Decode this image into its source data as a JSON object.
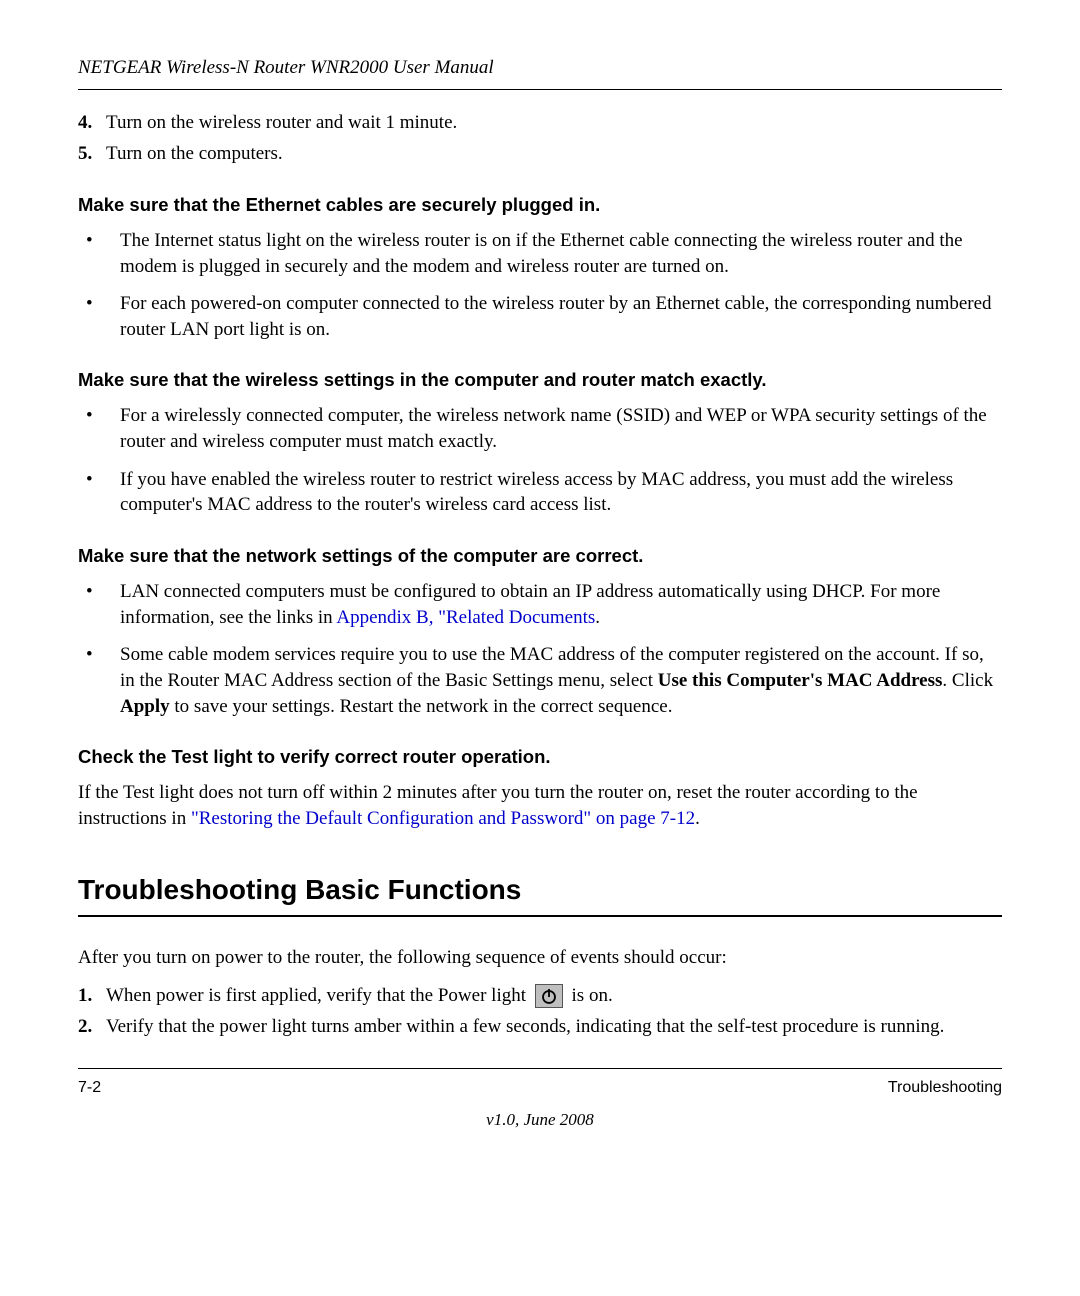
{
  "header": {
    "title": "NETGEAR Wireless-N Router WNR2000 User Manual"
  },
  "continued_list": [
    {
      "num": "4.",
      "text": "Turn on the wireless router and wait 1 minute."
    },
    {
      "num": "5.",
      "text": "Turn on the computers."
    }
  ],
  "sections": [
    {
      "heading": "Make sure that the Ethernet cables are securely plugged in.",
      "bullets": [
        {
          "text": "The Internet status light on the wireless router is on if the Ethernet cable connecting the wireless router and the modem is plugged in securely and the modem and wireless router are turned on."
        },
        {
          "text": "For each powered-on computer connected to the wireless router by an Ethernet cable, the corresponding numbered router LAN port light is on."
        }
      ]
    },
    {
      "heading": "Make sure that the wireless settings in the computer and router match exactly.",
      "bullets": [
        {
          "text": "For a wirelessly connected computer, the wireless network name (SSID) and WEP or WPA security settings of the router and wireless computer must match exactly."
        },
        {
          "text": "If you have enabled the wireless router to restrict wireless access by MAC address, you must add the wireless computer's MAC address to the router's wireless card access list."
        }
      ]
    },
    {
      "heading": "Make sure that the network settings of the computer are correct.",
      "bullets": [
        {
          "pre": "LAN connected computers must be configured to obtain an IP address automatically using DHCP. For more information, see the links in ",
          "link": "Appendix B, \"Related Documents",
          "post": "."
        },
        {
          "pre": "Some cable modem services require you to use the MAC address of the computer registered on the account. If so, in the Router MAC Address section of the Basic Settings menu, select ",
          "bold1": "Use this Computer's MAC Address",
          "mid": ". Click ",
          "bold2": "Apply",
          "post": " to save your settings. Restart the network in the correct sequence."
        }
      ]
    },
    {
      "heading": "Check the Test light to verify correct router operation.",
      "paragraph": {
        "pre": "If the Test light does not turn off within 2 minutes after you turn the router on, reset the router according to the instructions in ",
        "link": "\"Restoring the Default Configuration and Password\" on page 7-12",
        "post": "."
      }
    }
  ],
  "h2": "Troubleshooting Basic Functions",
  "intro": "After you turn on power to the router, the following sequence of events should occur:",
  "steps": [
    {
      "num": "1.",
      "pre": "When power is first applied, verify that the Power light ",
      "post": " is on."
    },
    {
      "num": "2.",
      "text": "Verify that the power light turns amber within a few seconds, indicating that the self-test procedure is running."
    }
  ],
  "footer": {
    "page": "7-2",
    "section": "Troubleshooting",
    "version": "v1.0, June 2008"
  }
}
